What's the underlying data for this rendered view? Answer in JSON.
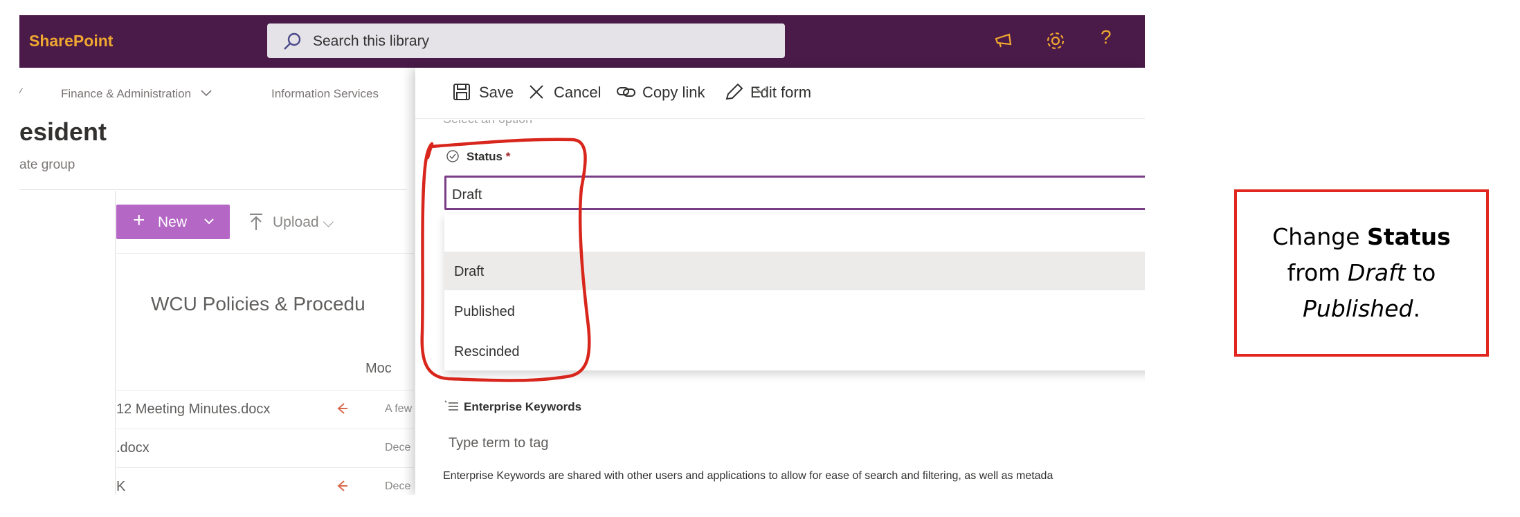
{
  "suite": {
    "brand": "SharePoint",
    "search_placeholder": "Search this library",
    "icons": [
      "megaphone-icon",
      "gear-icon",
      "help-icon"
    ],
    "help_label": "?"
  },
  "site": {
    "nav": [
      "Finance & Administration",
      "Information Services"
    ],
    "title": "esident",
    "subtitle": "ate group"
  },
  "library": {
    "new_label": "New",
    "upload_label": "Upload",
    "title": "WCU Policies & Procedu",
    "modified_header": "Moc",
    "files": [
      {
        "name": "12 Meeting Minutes.docx",
        "modified": "A few",
        "shared": true
      },
      {
        "name": ".docx",
        "modified": "Dece",
        "shared": false
      },
      {
        "name": "K",
        "modified": "Dece",
        "shared": true
      }
    ]
  },
  "panel": {
    "toolbar": {
      "save": "Save",
      "cancel": "Cancel",
      "copy_link": "Copy link",
      "edit_form": "Edit form"
    },
    "prev_field_text": "Select an option",
    "status_label": "Status",
    "required_mark": "*",
    "status_value": "Draft",
    "options": [
      {
        "label": "",
        "selected": false
      },
      {
        "label": "Draft",
        "selected": true
      },
      {
        "label": "Published",
        "selected": false
      },
      {
        "label": "Rescinded",
        "selected": false
      }
    ],
    "enterprise_label": "Enterprise Keywords",
    "enterprise_placeholder": "Type term to tag",
    "enterprise_help": "Enterprise Keywords are shared with other users and applications to allow for ease of search and filtering, as well as metada"
  },
  "callout": {
    "t1": "Change ",
    "t2": "Status",
    "t3": " from ",
    "t4": "Draft",
    "t5": " to ",
    "t6": "Published",
    "t7": "."
  },
  "colors": {
    "suitebar": "#4a1a48",
    "brand": "#f0a830",
    "new_button": "#b567c6",
    "dropdown_border": "#7a3e86",
    "annotation_red": "#e0261e"
  }
}
